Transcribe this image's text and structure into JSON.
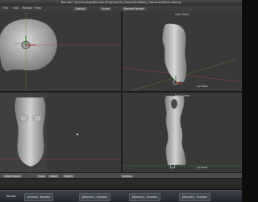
{
  "window": {
    "title": "Blender* [/home/rego/Blender/Projects/Ch_Character/Mesh_Character/Mesh.blend]"
  },
  "menubar": {
    "items": [
      "File",
      "Add",
      "Render",
      "Help"
    ],
    "screen_field": "Default",
    "scene_field": "Scene",
    "engine_field": "Blender Render"
  },
  "viewports": {
    "top_left": {
      "label": ""
    },
    "top_right": {
      "label": "User Ortho",
      "object_label": "(1) Plane"
    },
    "bottom_left": {
      "label": ""
    },
    "bottom_right": {
      "label": "Right Ortho",
      "object_label": "(1) Plane"
    }
  },
  "toolbar": {
    "mode": "Object Mode",
    "view": "View",
    "select": "Select",
    "object": "Object",
    "pivot": "Surface"
  },
  "taskbar": {
    "start_label": "Blender",
    "tasks": [
      "Untitled - Blender",
      "[Blender] - Untitled",
      "[Blender] - Untitled",
      "[Blender] - Untitled"
    ]
  }
}
